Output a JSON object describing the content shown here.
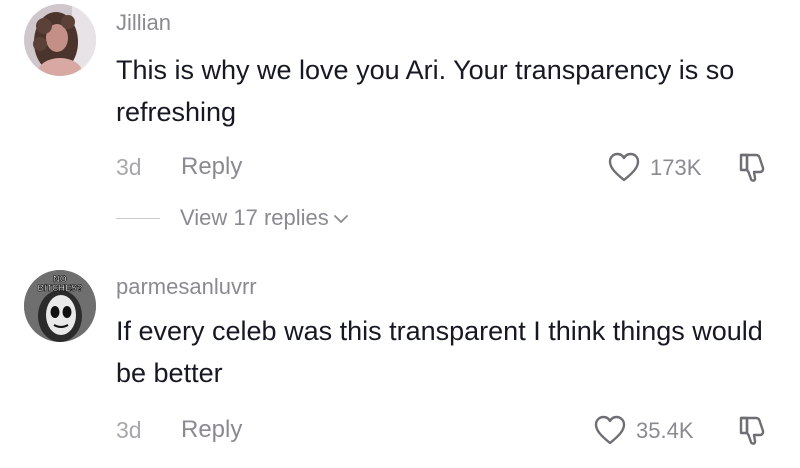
{
  "comments": [
    {
      "username": "Jillian",
      "text": "This is why we love you Ari. Your transparency is so refreshing",
      "time": "3d",
      "reply_label": "Reply",
      "likes": "173K",
      "view_replies": "View 17 replies",
      "avatar_icon": "user-photo-avatar",
      "avatar_colors": [
        "#a77a73",
        "#5b4138",
        "#d9b1ad"
      ]
    },
    {
      "username": "parmesanluvrr",
      "text": "If every celeb was this transparent I think things would be better",
      "time": "3d",
      "reply_label": "Reply",
      "likes": "35.4K",
      "avatar_icon": "meme-avatar",
      "avatar_overlay_text": "NO BITCHES?",
      "avatar_colors": [
        "#5a5a5a",
        "#e8e8e8",
        "#1a1a1a"
      ]
    }
  ],
  "colors": {
    "primary_text": "#161823",
    "secondary_text": "#8a8b91",
    "muted_text": "#a7a8ad",
    "background": "#ffffff"
  },
  "icons": {
    "like": "heart-outline-icon",
    "dislike": "thumbs-down-outline-icon",
    "expand": "chevron-down-icon"
  }
}
